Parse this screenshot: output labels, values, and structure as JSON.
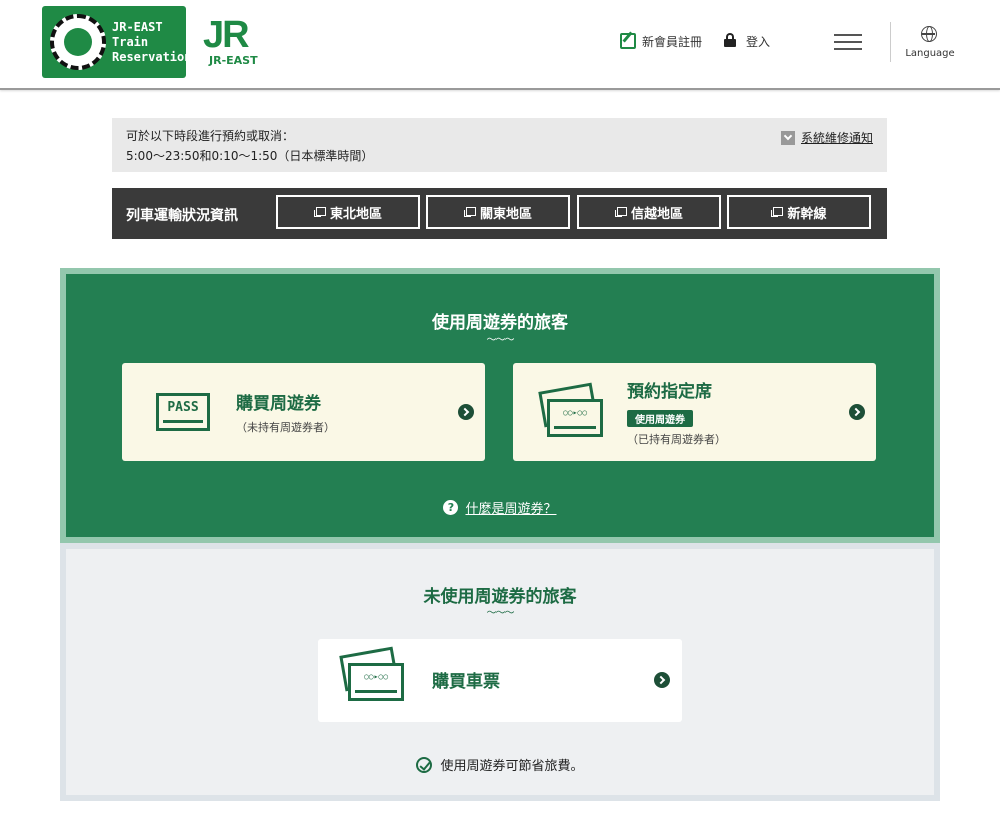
{
  "header": {
    "brand_text": "JR-EAST\nTrain\nReservation",
    "jr_logo": "JR",
    "jr_logo_sub": "JR-EAST",
    "register_label": "新會員註冊",
    "login_label": "登入",
    "language_label": "Language"
  },
  "notice": {
    "line1": "可於以下時段進行預約或取消：",
    "line2": "5:00～23:50和0:10～1:50（日本標準時間）",
    "maintenance_link": "系統維修通知"
  },
  "train_status": {
    "title": "列車運輸狀況資訊",
    "regions": [
      "東北地區",
      "關東地區",
      "信越地區",
      "新幹線"
    ]
  },
  "pass_section": {
    "title": "使用周遊券的旅客",
    "buy_pass": {
      "title": "購買周遊券",
      "subtitle": "（未持有周遊券者）",
      "icon_text": "PASS"
    },
    "reserve_seat": {
      "title": "預約指定席",
      "badge": "使用周遊券",
      "subtitle": "（已持有周遊券者）"
    },
    "what_is_pass": "什麼是周遊券？"
  },
  "nopass_section": {
    "title": "未使用周遊券的旅客",
    "buy_ticket": {
      "title": "購買車票"
    },
    "save_note": "使用周遊券可節省旅費。"
  },
  "icons": {
    "ticket_text": "○○▸○○"
  }
}
